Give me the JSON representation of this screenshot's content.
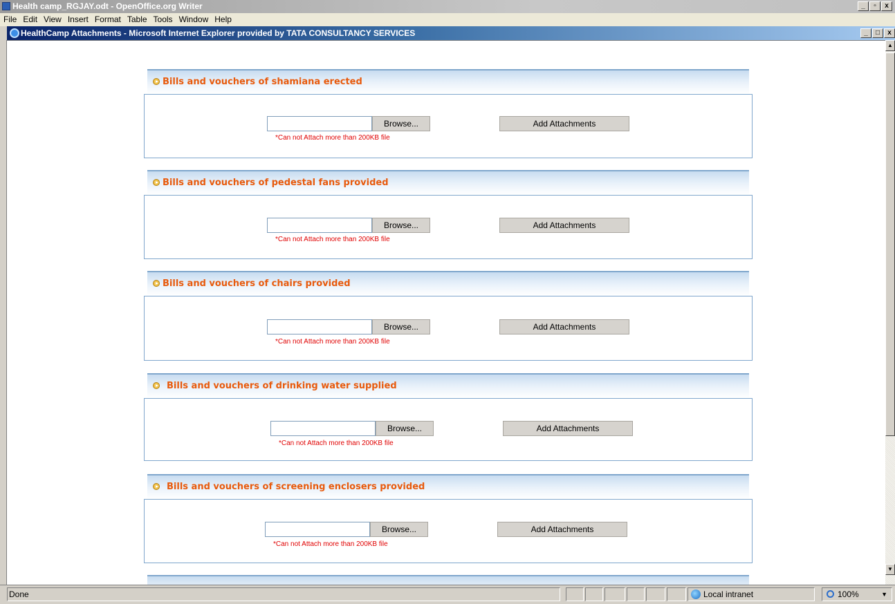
{
  "outer_window": {
    "title": "Health camp_RGJAY.odt - OpenOffice.org Writer",
    "buttons": [
      "_",
      "4",
      "X"
    ]
  },
  "menu": [
    "File",
    "Edit",
    "View",
    "Insert",
    "Format",
    "Table",
    "Tools",
    "Window",
    "Help"
  ],
  "ie_window": {
    "title": "HealthCamp Attachments - Microsoft Internet Explorer provided by TATA CONSULTANCY SERVICES",
    "buttons": [
      "_",
      "□",
      "X"
    ]
  },
  "sections": [
    {
      "title": "Bills and vouchers of shamiana erected",
      "browse_label": "Browse...",
      "add_label": "Add Attachments",
      "note": "*Can not Attach more than 200KB file"
    },
    {
      "title": "Bills and vouchers of pedestal fans provided",
      "browse_label": "Browse...",
      "add_label": "Add Attachments",
      "note": "*Can not Attach more than 200KB file"
    },
    {
      "title": "Bills and vouchers of chairs provided",
      "browse_label": "Browse...",
      "add_label": "Add Attachments",
      "note": "*Can not Attach more than 200KB file"
    },
    {
      "title": "Bills and vouchers of drinking water supplied",
      "browse_label": "Browse...",
      "add_label": "Add Attachments",
      "note": "*Can not Attach more than 200KB file"
    },
    {
      "title": "Bills and vouchers of screening enclosers provided",
      "browse_label": "Browse...",
      "add_label": "Add Attachments",
      "note": "*Can not Attach more than 200KB file"
    }
  ],
  "status": {
    "text": "Done",
    "zone": "Local intranet",
    "zoom": "100%"
  },
  "colors": {
    "section_title": "#e85a0c",
    "note": "#e00000",
    "border": "#7fa6cc"
  }
}
